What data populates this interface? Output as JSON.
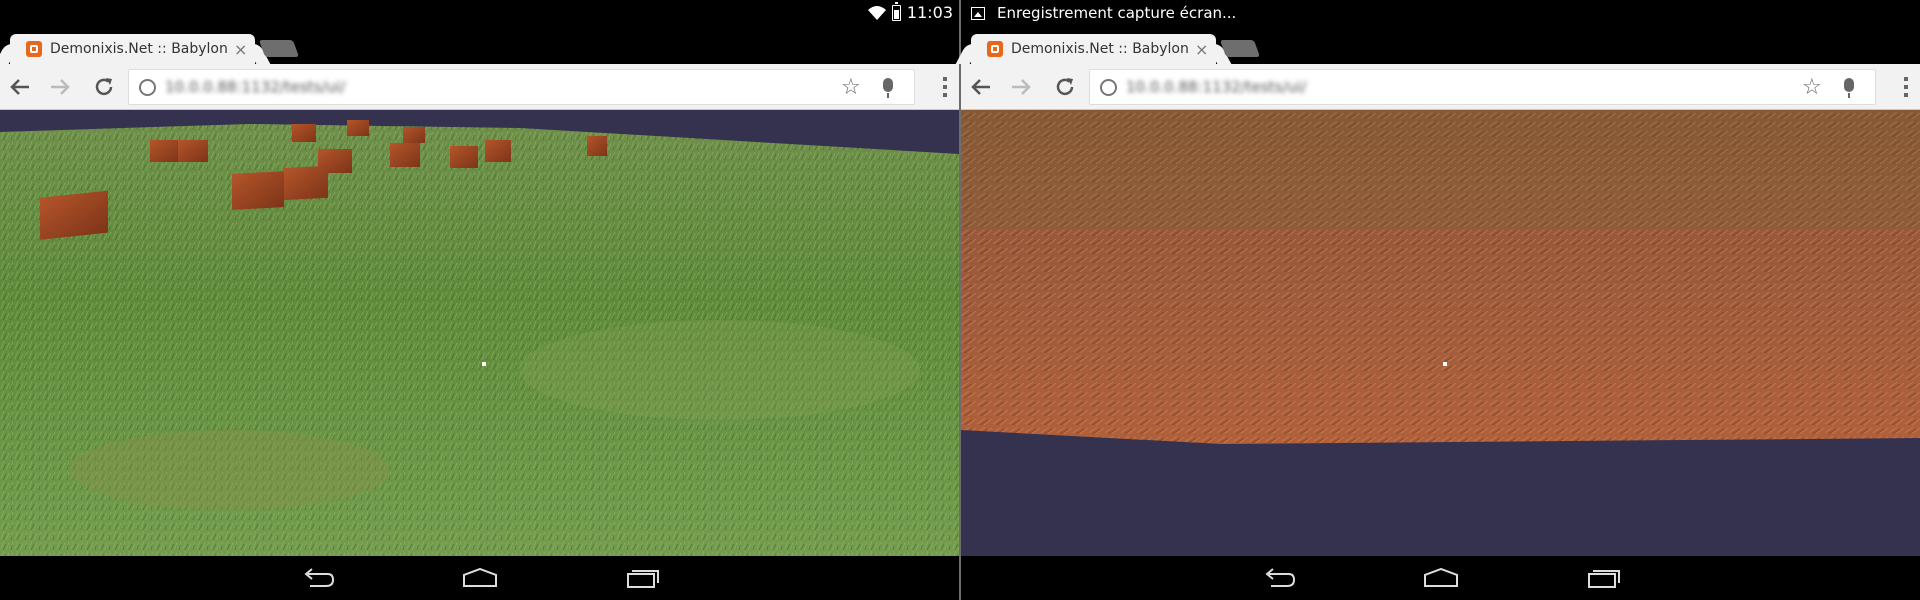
{
  "status": {
    "time": "11:03",
    "notification": "Enregistrement capture écran..."
  },
  "left": {
    "tab_title": "Demonixis.Net :: Babylon",
    "tab_close": "×",
    "url": "10.0.0.88:1132/tests/ui/",
    "icons": [
      "back-arrow-icon",
      "forward-arrow-icon",
      "reload-icon",
      "globe-icon",
      "star-icon",
      "mic-icon",
      "menu-icon"
    ]
  },
  "right": {
    "tab_title": "Demonixis.Net :: Babylon",
    "tab_close": "×",
    "url": "10.0.0.88:1132/tests/ui/",
    "icons": [
      "back-arrow-icon",
      "forward-arrow-icon",
      "reload-icon",
      "globe-icon",
      "star-icon",
      "mic-icon",
      "menu-icon"
    ]
  },
  "navbar_icons": [
    "back-nav-icon",
    "home-nav-icon",
    "recent-apps-icon"
  ],
  "colors": {
    "sky": "#35324f",
    "grass": "#5f8e3c",
    "grass_inverted": "#9c5a3c",
    "crate": "#9b4421",
    "favicon": "#e8671a"
  }
}
